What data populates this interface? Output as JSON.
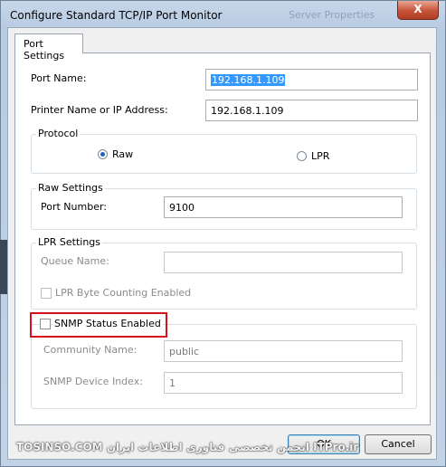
{
  "window": {
    "title": "Configure Standard TCP/IP Port Monitor",
    "ghost_title": "Server Properties",
    "close_glyph": "X"
  },
  "tabs": [
    {
      "label": "Port Settings"
    }
  ],
  "port_name": {
    "label": "Port Name:",
    "value": "192.168.1.109"
  },
  "printer_address": {
    "label": "Printer Name or IP Address:",
    "value": "192.168.1.109"
  },
  "protocol": {
    "label": "Protocol",
    "options": [
      {
        "label": "Raw",
        "selected": true
      },
      {
        "label": "LPR",
        "selected": false
      }
    ]
  },
  "raw_settings": {
    "label": "Raw Settings",
    "port_number_label": "Port Number:",
    "port_number": "9100"
  },
  "lpr_settings": {
    "label": "LPR Settings",
    "queue_name_label": "Queue Name:",
    "queue_name": "",
    "byte_counting_label": "LPR Byte Counting Enabled",
    "byte_counting_checked": false
  },
  "snmp": {
    "status_label": "SNMP Status Enabled",
    "status_checked": false,
    "community_label": "Community Name:",
    "community_value": "public",
    "device_index_label": "SNMP Device Index:",
    "device_index_value": "1"
  },
  "buttons": {
    "ok": "OK",
    "cancel": "Cancel"
  },
  "watermark": "TOSINSO.COM  انجمن تخصصی فناوری اطلاعات ایران  ITPro.ir",
  "colors": {
    "highlight": "#d9111c",
    "selection": "#3399ff",
    "close": "#c7533b"
  }
}
